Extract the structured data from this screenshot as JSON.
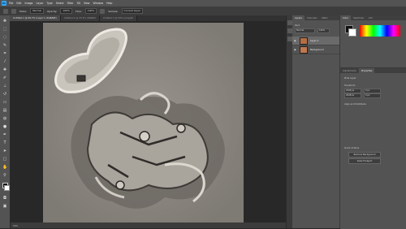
{
  "app": {
    "logo": "Ps"
  },
  "menu": [
    "File",
    "Edit",
    "Image",
    "Layer",
    "Type",
    "Select",
    "Filter",
    "3D",
    "View",
    "Window",
    "Help"
  ],
  "options": {
    "mode_label": "Mode:",
    "mode_value": "Normal",
    "opacity_label": "Opacity:",
    "opacity_value": "100%",
    "flow_label": "Flow:",
    "flow_value": "100%",
    "sample_label": "Sample:",
    "sample_value": "Current Layer"
  },
  "tabs": [
    "Untitled-1 @ 66.7% (Layer 1, RGB/8#)",
    "Untitled-2 @ 33.3% (RGB/8)",
    "Untitled-3 @ 50% (Gray/8)"
  ],
  "status": {
    "zoom": "50%"
  },
  "layers_panel": {
    "tabs": [
      "Layers",
      "Channels",
      "Paths"
    ],
    "kind_label": "Kind",
    "blend_value": "Normal",
    "opacity_value": "100%",
    "layers": [
      {
        "name": "Layer 1",
        "selected": true
      },
      {
        "name": "Background",
        "selected": false
      }
    ]
  },
  "side_tabs": [
    "Color",
    "Swatches",
    "Info"
  ],
  "properties": {
    "tabs": [
      "Adjustments",
      "Properties"
    ],
    "title": "Pixel Layer",
    "transform_label": "Transform",
    "w_value": "2048 px",
    "h_value": "2048 px",
    "x_value": "0 px",
    "y_value": "0 px",
    "align_label": "Align and Distribute",
    "quick_actions_label": "Quick Actions",
    "remove_bg": "Remove Background",
    "select_subject": "Select Subject"
  },
  "colors": {
    "accent": "#31a8ff",
    "panel": "#535353",
    "canvas_bg": "#282828"
  }
}
